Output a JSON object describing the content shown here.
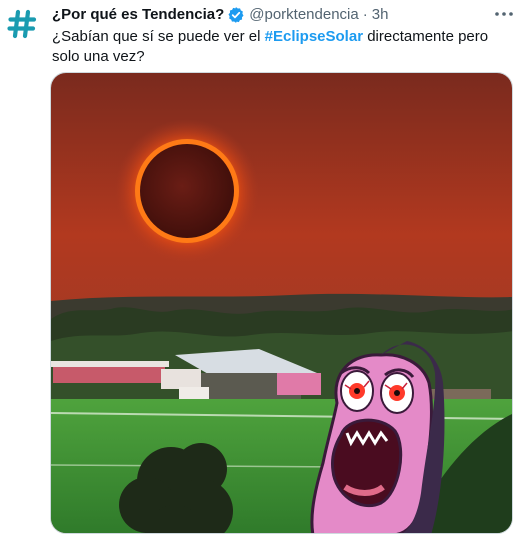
{
  "author": {
    "display_name": "¿Por qué es Tendencia?",
    "handle": "@porktendencia",
    "separator": "·",
    "time": "3h",
    "verified": true,
    "avatar_icon": "hashtag-icon"
  },
  "tweet": {
    "text_before": "¿Sabían que sí se puede ver el ",
    "hashtag": "#EclipseSolar",
    "text_after": " directamente pero solo una vez?"
  },
  "icons": {
    "more": "more-horizontal-icon",
    "verified": "verified-badge-icon"
  },
  "colors": {
    "hashtag": "#1d9bf0",
    "secondary_text": "#536471",
    "avatar": "#1a9bb0",
    "verified": "#1d9bf0"
  }
}
